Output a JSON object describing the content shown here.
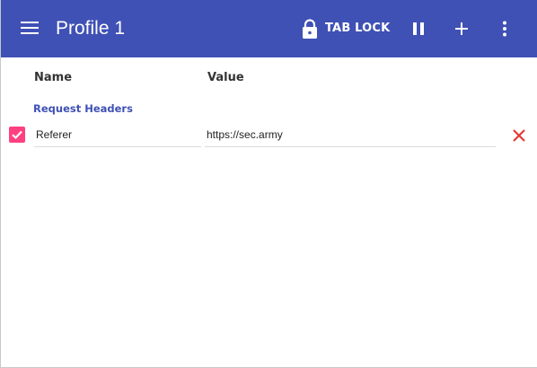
{
  "appbar": {
    "title": "Profile 1",
    "tab_lock_label": "TAB LOCK",
    "background_color": "#3f51b5",
    "icons": {
      "menu": "hamburger-menu-icon",
      "lock": "lock-icon",
      "pause": "pause-icon",
      "add": "plus-icon",
      "more": "more-vertical-icon"
    }
  },
  "columns": {
    "name": "Name",
    "value": "Value"
  },
  "sections": [
    {
      "label": "Request Headers",
      "color": "#3f51b5",
      "rows": [
        {
          "enabled": true,
          "name": "Referer",
          "value": "https://sec.army",
          "checkbox_color": "#ff4081",
          "delete_icon": "close-icon",
          "delete_color": "#e53935"
        }
      ]
    }
  ]
}
